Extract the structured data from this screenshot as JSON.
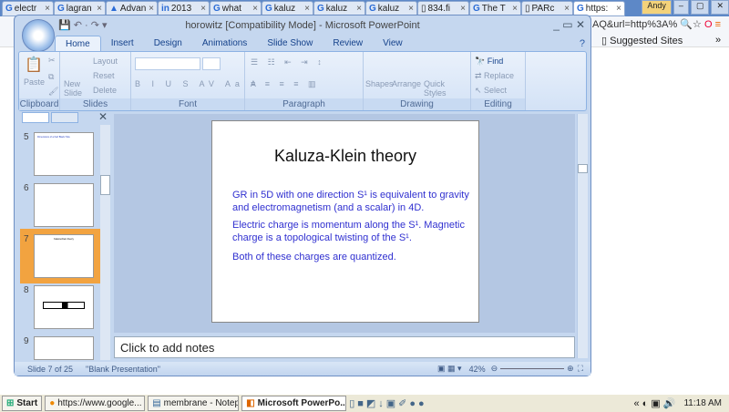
{
  "browser": {
    "tabs": [
      {
        "label": "electr"
      },
      {
        "label": "lagran"
      },
      {
        "label": "Advan"
      },
      {
        "label": "2013"
      },
      {
        "label": "what"
      },
      {
        "label": "kaluz"
      },
      {
        "label": "kaluz"
      },
      {
        "label": "kaluz"
      },
      {
        "label": "834.fi"
      },
      {
        "label": "The T"
      },
      {
        "label": "PARc"
      },
      {
        "label": "https:"
      }
    ],
    "user": "Andy",
    "url_fragment": "AQ&url=http%3A%",
    "bookmark": "Suggested Sites"
  },
  "ppt": {
    "title": "horowitz [Compatibility Mode] - Microsoft PowerPoint",
    "tabs": [
      "Home",
      "Insert",
      "Design",
      "Animations",
      "Slide Show",
      "Review",
      "View"
    ],
    "ribbon": {
      "clipboard": {
        "label": "Clipboard",
        "paste": "Paste"
      },
      "slides": {
        "label": "Slides",
        "new_slide": "New Slide",
        "layout": "Layout",
        "reset": "Reset",
        "delete": "Delete"
      },
      "font": {
        "label": "Font"
      },
      "paragraph": {
        "label": "Paragraph"
      },
      "drawing": {
        "label": "Drawing",
        "shapes": "Shapes",
        "arrange": "Arrange",
        "quick_styles": "Quick Styles"
      },
      "editing": {
        "label": "Editing",
        "find": "Find",
        "replace": "Replace",
        "select": "Select"
      }
    },
    "thumbnails": [
      {
        "num": "5",
        "title": "Dimensions of a Karl Black Hole"
      },
      {
        "num": "6"
      },
      {
        "num": "7",
        "title": "Kaluza-Klein theory"
      },
      {
        "num": "8"
      },
      {
        "num": "9"
      }
    ],
    "slide": {
      "title": "Kaluza-Klein theory",
      "p1": "GR in 5D with one direction S¹ is equivalent to gravity and electromagnetism (and a scalar) in 4D.",
      "p2": "Electric charge is momentum along the S¹. Magnetic charge is a topological twisting of the S¹.",
      "p3": "Both of these charges are quantized."
    },
    "notes_placeholder": "Click to add notes",
    "status": {
      "slide": "Slide 7 of 25",
      "theme": "\"Blank Presentation\"",
      "zoom": "42%"
    }
  },
  "taskbar": {
    "start": "Start",
    "items": [
      "https://www.google...",
      "membrane - Notepad",
      "Microsoft PowerPo..."
    ],
    "time": "11:18 AM"
  }
}
